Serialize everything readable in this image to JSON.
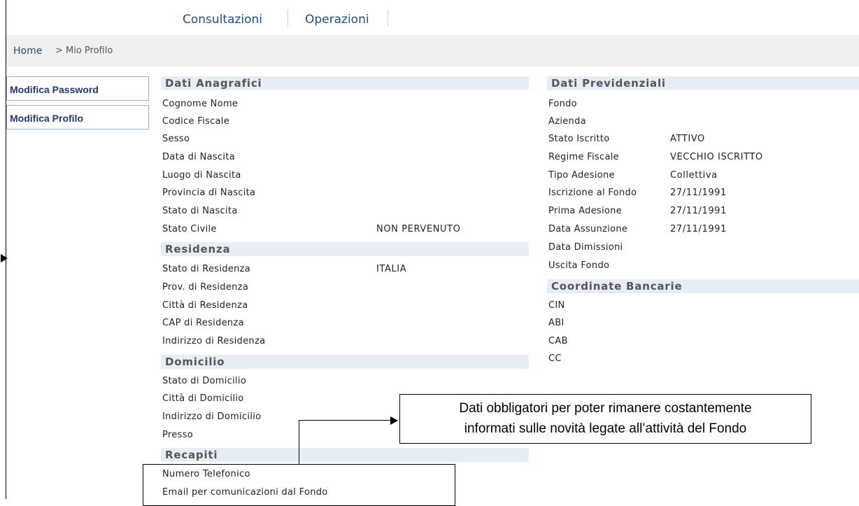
{
  "nav": {
    "consultazioni": "Consultazioni",
    "operazioni": "Operazioni"
  },
  "breadcrumb": {
    "home": "Home",
    "separator": ">",
    "current": "Mio Profilo"
  },
  "sidebar": {
    "modifica_password": "Modifica Password",
    "modifica_profilo": "Modifica Profilo"
  },
  "anagrafici": {
    "title": "Dati Anagrafici",
    "cognome_nome": "Cognome Nome",
    "codice_fiscale": "Codice Fiscale",
    "sesso": "Sesso",
    "data_nascita": "Data di Nascita",
    "luogo_nascita": "Luogo di Nascita",
    "provincia_nascita": "Provincia di Nascita",
    "stato_nascita": "Stato di Nascita",
    "stato_civile": "Stato Civile",
    "stato_civile_value": "NON PERVENUTO"
  },
  "residenza": {
    "title": "Residenza",
    "stato": "Stato di Residenza",
    "stato_value": "ITALIA",
    "prov": "Prov. di Residenza",
    "citta": "Città di Residenza",
    "cap": "CAP di Residenza",
    "indirizzo": "Indirizzo di Residenza"
  },
  "domicilio": {
    "title": "Domicilio",
    "stato": "Stato di Domicilio",
    "citta": "Città di Domicilio",
    "indirizzo": "Indirizzo di Domicilio",
    "presso": "Presso"
  },
  "recapiti": {
    "title": "Recapiti",
    "telefono": "Numero Telefonico",
    "email": "Email per comunicazioni dal Fondo"
  },
  "previdenziali": {
    "title": "Dati Previdenziali",
    "fondo": "Fondo",
    "azienda": "Azienda",
    "stato_iscritto": "Stato Iscritto",
    "stato_iscritto_value": "ATTIVO",
    "regime_fiscale": "Regime Fiscale",
    "regime_fiscale_value": "VECCHIO ISCRITTO",
    "tipo_adesione": "Tipo Adesione",
    "tipo_adesione_value": "Collettiva",
    "iscrizione_fondo": "Iscrizione al Fondo",
    "iscrizione_fondo_value": "27/11/1991",
    "prima_adesione": "Prima Adesione",
    "prima_adesione_value": "27/11/1991",
    "data_assunzione": "Data Assunzione",
    "data_assunzione_value": "27/11/1991",
    "data_dimissioni": "Data Dimissioni",
    "uscita_fondo": "Uscita Fondo"
  },
  "bancarie": {
    "title": "Coordinate Bancarie",
    "cin": "CIN",
    "abi": "ABI",
    "cab": "CAB",
    "cc": "CC"
  },
  "callout": {
    "line1": "Dati obbligatori per poter rimanere costantemente",
    "line2": "informati sulle novità legate all’attività del Fondo"
  }
}
